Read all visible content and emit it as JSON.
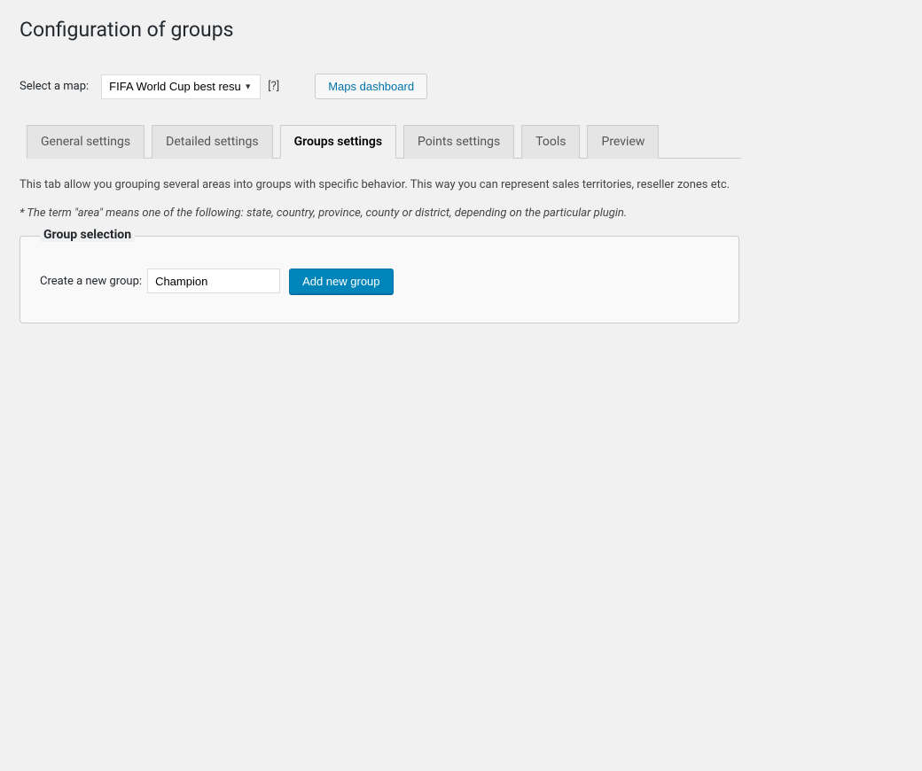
{
  "pageTitle": "Configuration of groups",
  "mapRow": {
    "label": "Select a map:",
    "selectedOption": "FIFA World Cup best resu",
    "helpText": "[?]",
    "dashboardButton": "Maps dashboard"
  },
  "tabs": [
    {
      "label": "General settings",
      "active": false
    },
    {
      "label": "Detailed settings",
      "active": false
    },
    {
      "label": "Groups settings",
      "active": true
    },
    {
      "label": "Points settings",
      "active": false
    },
    {
      "label": "Tools",
      "active": false
    },
    {
      "label": "Preview",
      "active": false
    }
  ],
  "description": "This tab allow you grouping several areas into groups with specific behavior. This way you can represent sales territories, reseller zones etc.",
  "note": "* The term \"area\" means one of the following: state, country, province, county or district, depending on the particular plugin.",
  "groupSelection": {
    "legend": "Group selection",
    "createLabel": "Create a new group:",
    "inputValue": "Champion",
    "addButton": "Add new group"
  }
}
